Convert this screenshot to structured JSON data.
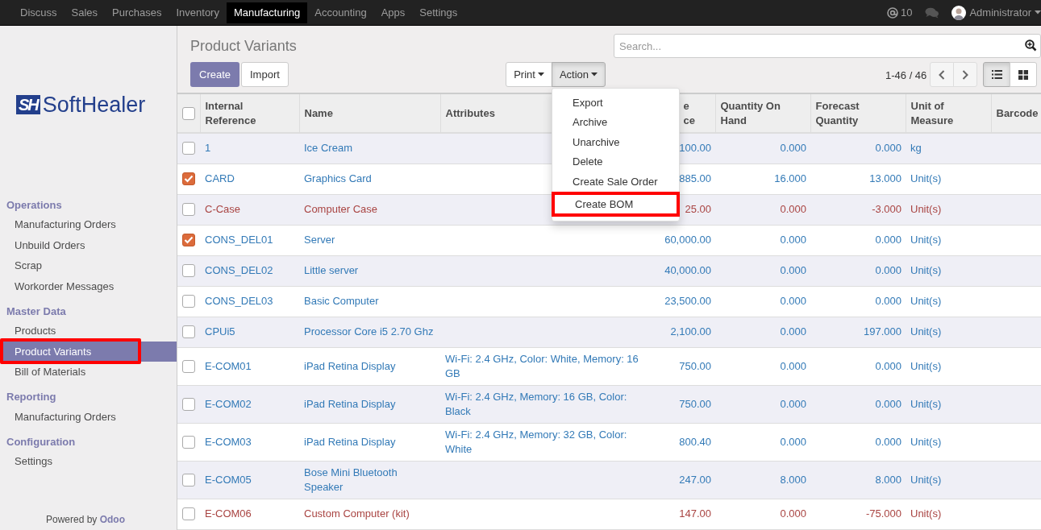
{
  "top_menu": [
    {
      "label": "Discuss",
      "selected": false
    },
    {
      "label": "Sales",
      "selected": false
    },
    {
      "label": "Purchases",
      "selected": false
    },
    {
      "label": "Inventory",
      "selected": false
    },
    {
      "label": "Manufacturing",
      "selected": true
    },
    {
      "label": "Accounting",
      "selected": false
    },
    {
      "label": "Apps",
      "selected": false
    },
    {
      "label": "Settings",
      "selected": false
    }
  ],
  "systray": {
    "mentions": "10",
    "user": "Administrator"
  },
  "logo": {
    "mark": "SH",
    "text": "SoftHealer"
  },
  "sidebar": [
    {
      "heading": "Operations",
      "items": [
        {
          "label": "Manufacturing Orders",
          "selected": false,
          "outlined": false
        },
        {
          "label": "Unbuild Orders",
          "selected": false,
          "outlined": false
        },
        {
          "label": "Scrap",
          "selected": false,
          "outlined": false
        },
        {
          "label": "Workorder Messages",
          "selected": false,
          "outlined": false
        }
      ]
    },
    {
      "heading": "Master Data",
      "items": [
        {
          "label": "Products",
          "selected": false,
          "outlined": false
        },
        {
          "label": "Product Variants",
          "selected": true,
          "outlined": true
        },
        {
          "label": "Bill of Materials",
          "selected": false,
          "outlined": false
        }
      ]
    },
    {
      "heading": "Reporting",
      "items": [
        {
          "label": "Manufacturing Orders",
          "selected": false,
          "outlined": false
        }
      ]
    },
    {
      "heading": "Configuration",
      "items": [
        {
          "label": "Settings",
          "selected": false,
          "outlined": false
        }
      ]
    }
  ],
  "footer": "Powered by **Odoo**",
  "title": "Product Variants",
  "search": {
    "placeholder": "Search..."
  },
  "buttons": {
    "create": "Create",
    "import": "Import",
    "print": "Print",
    "action": "Action"
  },
  "pager": "1-46 / 46",
  "views": [
    {
      "kind": "list",
      "selected": true
    },
    {
      "kind": "kanban",
      "selected": false
    }
  ],
  "action_menu": [
    {
      "label": "Export",
      "outlined": false
    },
    {
      "label": "Archive",
      "outlined": false
    },
    {
      "label": "Unarchive",
      "outlined": false
    },
    {
      "label": "Delete",
      "outlined": false
    },
    {
      "label": "Create Sale Order",
      "outlined": false
    },
    {
      "label": "Create BOM",
      "outlined": true
    }
  ],
  "table": {
    "select_all": false,
    "columns": [
      "Internal Reference",
      "Name",
      "Attributes",
      "e ce",
      "Quantity On Hand",
      "Forecast Quantity",
      "Unit of Measure",
      "Barcode"
    ],
    "rows": [
      {
        "checked": false,
        "alert": false,
        "cells": [
          "1",
          "Ice Cream",
          "",
          "100.00",
          "0.000",
          "0.000",
          "kg",
          ""
        ]
      },
      {
        "checked": true,
        "alert": false,
        "cells": [
          "CARD",
          "Graphics Card",
          "",
          "885.00",
          "16.000",
          "13.000",
          "Unit(s)",
          ""
        ]
      },
      {
        "checked": false,
        "alert": true,
        "cells": [
          "C-Case",
          "Computer Case",
          "",
          "25.00",
          "0.000",
          "-3.000",
          "Unit(s)",
          ""
        ]
      },
      {
        "checked": true,
        "alert": false,
        "cells": [
          "CONS_DEL01",
          "Server",
          "",
          "60,000.00",
          "0.000",
          "0.000",
          "Unit(s)",
          ""
        ]
      },
      {
        "checked": false,
        "alert": false,
        "cells": [
          "CONS_DEL02",
          "Little server",
          "",
          "40,000.00",
          "0.000",
          "0.000",
          "Unit(s)",
          ""
        ]
      },
      {
        "checked": false,
        "alert": false,
        "cells": [
          "CONS_DEL03",
          "Basic Computer",
          "",
          "23,500.00",
          "0.000",
          "0.000",
          "Unit(s)",
          ""
        ]
      },
      {
        "checked": false,
        "alert": false,
        "cells": [
          "CPUi5",
          "Processor Core i5 2.70 Ghz",
          "",
          "2,100.00",
          "0.000",
          "197.000",
          "Unit(s)",
          ""
        ]
      },
      {
        "checked": false,
        "alert": false,
        "cells": [
          "E-COM01",
          "iPad Retina Display",
          "Wi-Fi: 2.4 GHz, Color: White, Memory: 16 GB",
          "750.00",
          "0.000",
          "0.000",
          "Unit(s)",
          ""
        ]
      },
      {
        "checked": false,
        "alert": false,
        "cells": [
          "E-COM02",
          "iPad Retina Display",
          "Wi-Fi: 2.4 GHz, Memory: 16 GB, Color: Black",
          "750.00",
          "0.000",
          "0.000",
          "Unit(s)",
          ""
        ]
      },
      {
        "checked": false,
        "alert": false,
        "cells": [
          "E-COM03",
          "iPad Retina Display",
          "Wi-Fi: 2.4 GHz, Memory: 32 GB, Color: White",
          "800.40",
          "0.000",
          "0.000",
          "Unit(s)",
          ""
        ]
      },
      {
        "checked": false,
        "alert": false,
        "cells": [
          "E-COM05",
          "Bose Mini Bluetooth Speaker",
          "",
          "247.00",
          "8.000",
          "8.000",
          "Unit(s)",
          ""
        ]
      },
      {
        "checked": false,
        "alert": true,
        "cells": [
          "E-COM06",
          "Custom Computer (kit)",
          "",
          "147.00",
          "0.000",
          "-75.000",
          "Unit(s)",
          ""
        ]
      }
    ]
  }
}
